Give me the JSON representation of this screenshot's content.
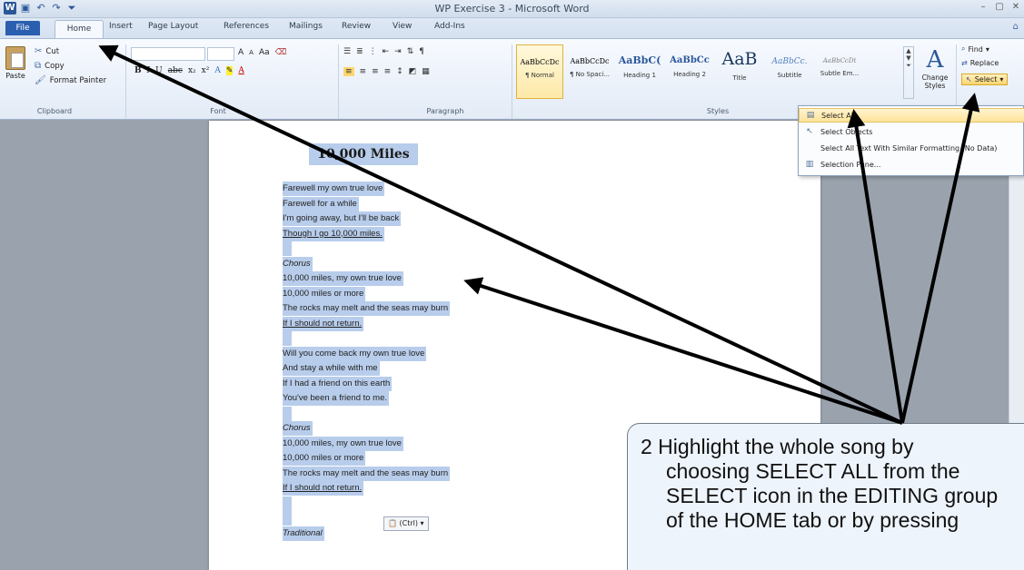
{
  "window": {
    "title": "WP Exercise 3 - Microsoft Word"
  },
  "tabs": [
    "File",
    "Home",
    "Insert",
    "Page Layout",
    "References",
    "Mailings",
    "Review",
    "View",
    "Add-Ins"
  ],
  "clipboard": {
    "paste": "Paste",
    "cut": "Cut",
    "copy": "Copy",
    "format_painter": "Format Painter",
    "label": "Clipboard"
  },
  "font": {
    "label": "Font",
    "grow": "A",
    "shrink": "A",
    "change_case": "Aa",
    "bold": "B",
    "italic": "I",
    "underline": "U",
    "subscript": "x₂",
    "superscript": "x²"
  },
  "paragraph": {
    "label": "Paragraph"
  },
  "styles": {
    "label": "Styles",
    "items": [
      {
        "sample": "AaBbCcDc",
        "name": "¶ Normal"
      },
      {
        "sample": "AaBbCcDc",
        "name": "¶ No Spaci..."
      },
      {
        "sample": "AaBbC(",
        "name": "Heading 1"
      },
      {
        "sample": "AaBbCc",
        "name": "Heading 2"
      },
      {
        "sample": "AaB",
        "name": "Title"
      },
      {
        "sample": "AaBbCc.",
        "name": "Subtitle"
      },
      {
        "sample": "AaBbCcDt",
        "name": "Subtle Em..."
      }
    ],
    "change_styles": "Change Styles"
  },
  "editing": {
    "find": "Find",
    "replace": "Replace",
    "select": "Select"
  },
  "select_menu": [
    "Select All",
    "Select Objects",
    "Select All Text With Similar Formatting (No Data)",
    "Selection Pane..."
  ],
  "document": {
    "title": "10,000 Miles",
    "lines": [
      {
        "t": "Farewell my own true love",
        "s": ""
      },
      {
        "t": "Farewell for a while",
        "s": ""
      },
      {
        "t": "I'm going away, but I'll be back",
        "s": ""
      },
      {
        "t": "Though I go 10,000 miles.",
        "s": "ul"
      },
      {
        "t": "",
        "s": "blank"
      },
      {
        "t": "Chorus",
        "s": "it"
      },
      {
        "t": "10,000 miles, my own true love",
        "s": ""
      },
      {
        "t": "10,000 miles or more",
        "s": ""
      },
      {
        "t": "The rocks may melt and the seas may burn",
        "s": ""
      },
      {
        "t": "If I should not return.",
        "s": "ul"
      },
      {
        "t": "",
        "s": "blank"
      },
      {
        "t": "Will you come back my own true love",
        "s": ""
      },
      {
        "t": "And stay a while with me",
        "s": ""
      },
      {
        "t": "If I had a friend on this earth",
        "s": ""
      },
      {
        "t": "You've been a friend to me.",
        "s": ""
      },
      {
        "t": "",
        "s": "blank"
      },
      {
        "t": "Chorus",
        "s": "it"
      },
      {
        "t": "10,000 miles, my own true love",
        "s": ""
      },
      {
        "t": "10,000 miles or more",
        "s": ""
      },
      {
        "t": "The rocks may melt and the seas may burn",
        "s": ""
      },
      {
        "t": "If I should not return.",
        "s": "ul"
      },
      {
        "t": "",
        "s": "blank"
      },
      {
        "t": "",
        "s": "blank"
      },
      {
        "t": "Traditional",
        "s": "it"
      }
    ],
    "paste_options": "(Ctrl)"
  },
  "callout": {
    "lines": [
      "2  Highlight the whole song by",
      "choosing SELECT ALL from the",
      "SELECT icon in the EDITING group",
      "of the HOME tab or by pressing"
    ]
  }
}
